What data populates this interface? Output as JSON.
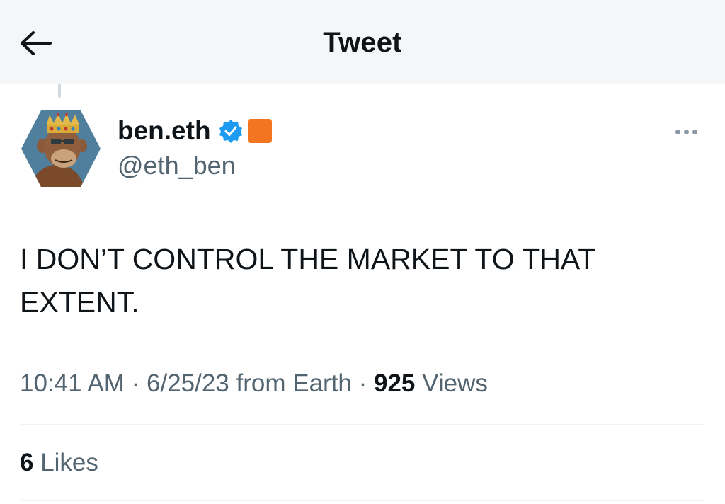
{
  "header": {
    "title": "Tweet",
    "back_icon": "arrow-left-icon"
  },
  "tweet": {
    "author": {
      "display_name": "ben.eth",
      "handle": "@eth_ben",
      "verified_icon": "verified-badge-icon",
      "affiliate_badge_color": "#f47521",
      "verified_color": "#1d9bf0"
    },
    "more_icon": "more-options-icon",
    "text": "I DON’T CONTROL THE MARKET TO THAT EXTENT.",
    "meta": {
      "time": "10:41 AM",
      "separator": " · ",
      "date": "6/25/23",
      "source": " from Earth",
      "views_count": "925",
      "views_label": " Views"
    },
    "likes": {
      "count": "6",
      "label": " Likes"
    }
  }
}
